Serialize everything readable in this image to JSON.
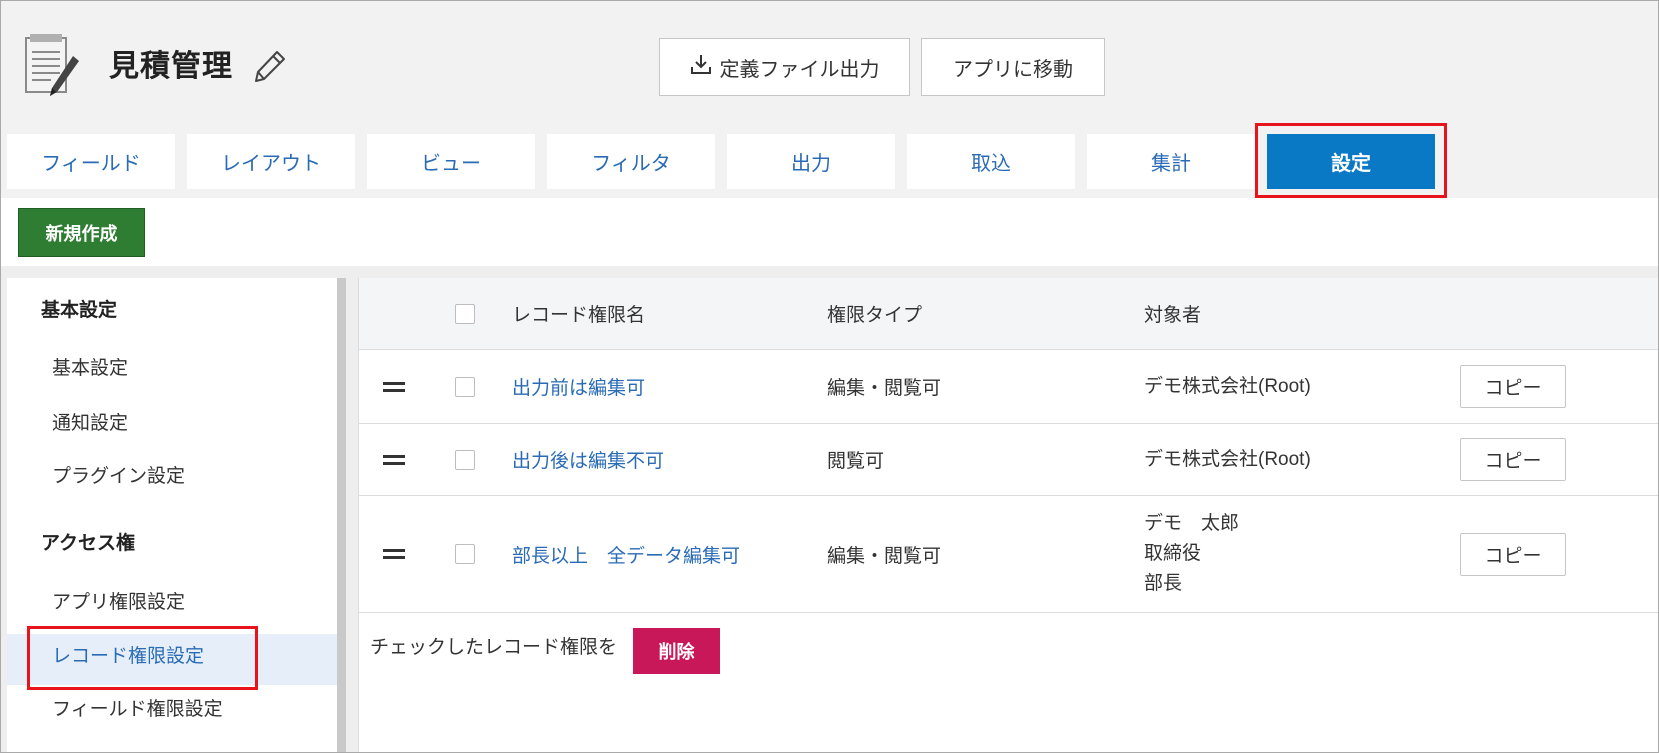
{
  "app": {
    "title": "見積管理",
    "icon": "document-pen-icon",
    "edit_icon": "pencil-icon"
  },
  "header_buttons": {
    "export_label": "定義ファイル出力",
    "export_icon": "download-icon",
    "goto_app_label": "アプリに移動"
  },
  "tabs": [
    {
      "label": "フィールド",
      "active": false
    },
    {
      "label": "レイアウト",
      "active": false
    },
    {
      "label": "ビュー",
      "active": false
    },
    {
      "label": "フィルタ",
      "active": false
    },
    {
      "label": "出力",
      "active": false
    },
    {
      "label": "取込",
      "active": false
    },
    {
      "label": "集計",
      "active": false
    },
    {
      "label": "設定",
      "active": true
    }
  ],
  "new_button_label": "新規作成",
  "sidebar": {
    "sections": [
      {
        "heading": "基本設定",
        "items": [
          "基本設定",
          "通知設定",
          "プラグイン設定"
        ]
      },
      {
        "heading": "アクセス権",
        "items": [
          "アプリ権限設定",
          "レコード権限設定",
          "フィールド権限設定"
        ]
      }
    ],
    "selected": "レコード権限設定"
  },
  "table": {
    "columns": [
      "レコード権限名",
      "権限タイプ",
      "対象者"
    ],
    "copy_label": "コピー",
    "rows": [
      {
        "name": "出力前は編集可",
        "type": "編集・閲覧可",
        "targets": [
          "デモ株式会社(Root)"
        ],
        "checked": false
      },
      {
        "name": "出力後は編集不可",
        "type": "閲覧可",
        "targets": [
          "デモ株式会社(Root)"
        ],
        "checked": false
      },
      {
        "name": "部長以上　全データ編集可",
        "type": "編集・閲覧可",
        "targets": [
          "デモ　太郎",
          "取締役",
          "部長"
        ],
        "checked": false
      }
    ]
  },
  "footer": {
    "text": "チェックしたレコード権限を",
    "delete_label": "削除"
  },
  "colors": {
    "active_tab": "#0a79c5",
    "tab_text": "#2a6bb5",
    "new_button": "#2e7d32",
    "delete_button": "#c8185a",
    "link": "#2a6bb5",
    "annotation_box": "#e8141c",
    "selected_item_bg": "#e6eff9"
  }
}
